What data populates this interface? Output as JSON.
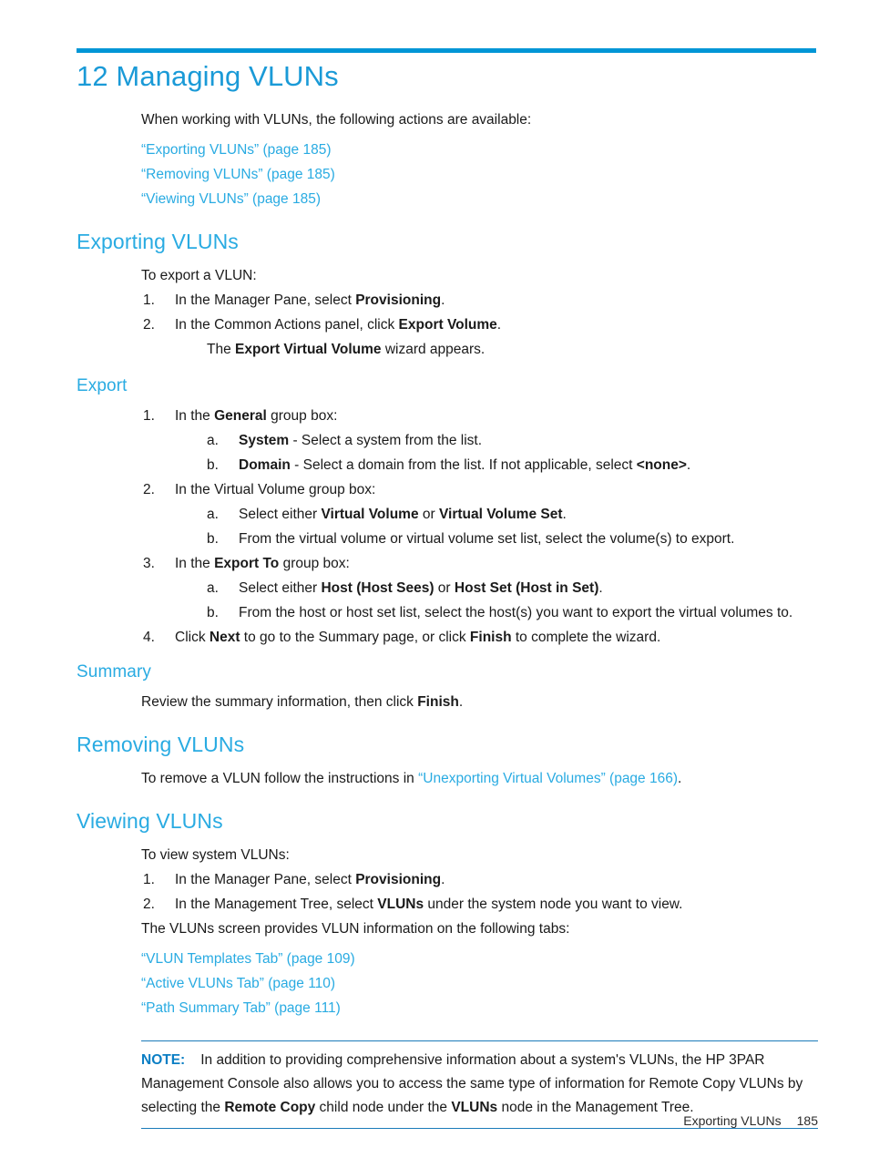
{
  "document": {
    "chapter_title": "12 Managing VLUNs",
    "intro": "When working with VLUNs, the following actions are available:",
    "intro_links": [
      "“Exporting VLUNs” (page 185)",
      "“Removing VLUNs” (page 185)",
      "“Viewing VLUNs” (page 185)"
    ]
  },
  "exporting": {
    "heading": "Exporting VLUNs",
    "lead": "To export a VLUN:",
    "steps": [
      {
        "marker": "1.",
        "text_pre": "In the Manager Pane, select ",
        "bold": "Provisioning",
        "text_post": "."
      },
      {
        "marker": "2.",
        "text_pre": "In the Common Actions panel, click ",
        "bold": "Export Volume",
        "text_post": "."
      }
    ],
    "step2_cont_pre": "The ",
    "step2_cont_bold": "Export Virtual Volume",
    "step2_cont_post": " wizard appears."
  },
  "export_sub": {
    "heading": "Export",
    "step1": {
      "marker": "1.",
      "pre": "In the ",
      "bold": "General",
      "post": " group box:"
    },
    "step1a": {
      "marker": "a.",
      "bold": "System",
      "post": " - Select a system from the list."
    },
    "step1b": {
      "marker": "b.",
      "bold": "Domain",
      "mid": " - Select a domain from the list. If not applicable, select ",
      "bold2": "<none>",
      "post": "."
    },
    "step2": {
      "marker": "2.",
      "text": "In the Virtual Volume group box:"
    },
    "step2a": {
      "marker": "a.",
      "pre": "Select either ",
      "bold": "Virtual Volume",
      "mid": " or ",
      "bold2": "Virtual Volume Set",
      "post": "."
    },
    "step2b": {
      "marker": "b.",
      "text": "From the virtual volume or virtual volume set list, select the volume(s) to export."
    },
    "step3": {
      "marker": "3.",
      "pre": "In the ",
      "bold": "Export To",
      "post": " group box:"
    },
    "step3a": {
      "marker": "a.",
      "pre": "Select either ",
      "bold": "Host (Host Sees)",
      "mid": " or ",
      "bold2": "Host Set (Host in Set)",
      "post": "."
    },
    "step3b": {
      "marker": "b.",
      "text": "From the host or host set list, select the host(s) you want to export the virtual volumes to."
    },
    "step4": {
      "marker": "4.",
      "pre": "Click ",
      "bold": "Next",
      "mid": " to go to the Summary page, or click ",
      "bold2": "Finish",
      "post": " to complete the wizard."
    }
  },
  "summary_sub": {
    "heading": "Summary",
    "pre": "Review the summary information, then click ",
    "bold": "Finish",
    "post": "."
  },
  "removing": {
    "heading": "Removing VLUNs",
    "pre": "To remove a VLUN follow the instructions in ",
    "link": "“Unexporting Virtual Volumes” (page 166)",
    "post": "."
  },
  "viewing": {
    "heading": "Viewing VLUNs",
    "lead": "To view system VLUNs:",
    "step1": {
      "marker": "1.",
      "pre": "In the Manager Pane, select ",
      "bold": "Provisioning",
      "post": "."
    },
    "step2": {
      "marker": "2.",
      "pre": "In the Management Tree, select ",
      "bold": "VLUNs",
      "post": " under the system node you want to view."
    },
    "tabs_lead": "The VLUNs screen provides VLUN information on the following tabs:",
    "tab_links": [
      "“VLUN Templates Tab” (page 109)",
      "“Active VLUNs Tab” (page 110)",
      "“Path Summary Tab” (page 111)"
    ]
  },
  "note": {
    "label": "NOTE:",
    "text_1": "In addition to providing comprehensive information about a system's VLUNs, the HP 3PAR Management Console also allows you to access the same type of information for Remote Copy VLUNs by selecting the ",
    "bold_1": "Remote Copy",
    "text_2": " child node under the ",
    "bold_2": "VLUNs",
    "text_3": " node in the Management Tree."
  },
  "footer": {
    "running_head": "Exporting VLUNs",
    "page_number": "185"
  },
  "colors": {
    "rule_blue": "#0096d6",
    "heading_blue": "#29abe2",
    "link_blue": "#29abe2",
    "note_rule_blue": "#1a7bb9",
    "note_label_blue": "#0a7ec4"
  }
}
